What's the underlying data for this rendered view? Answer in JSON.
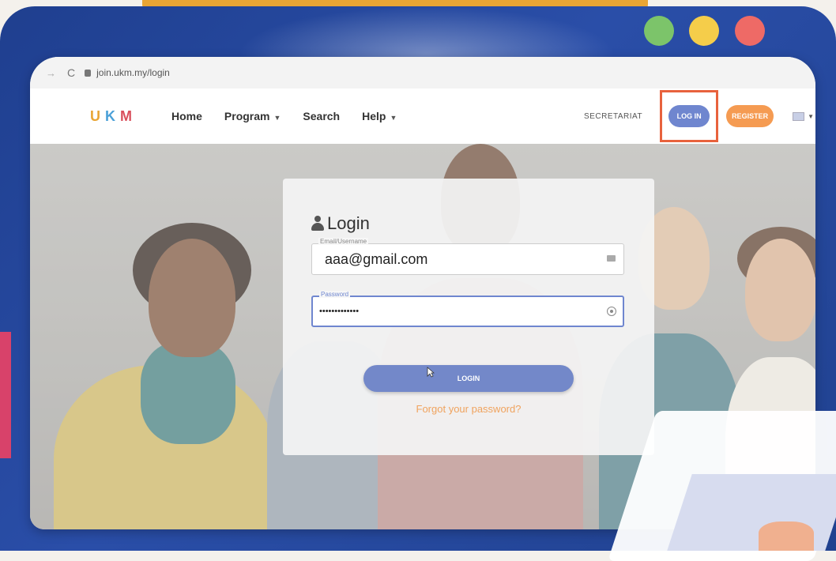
{
  "browser": {
    "url": "join.ukm.my/login"
  },
  "navbar": {
    "logo": {
      "u": "U",
      "k": "K",
      "m": "M"
    },
    "links": [
      {
        "label": "Home"
      },
      {
        "label": "Program"
      },
      {
        "label": "Search"
      },
      {
        "label": "Help"
      }
    ],
    "secretariat_label": "SECRETARIAT",
    "login_label": "LOG IN",
    "register_label": "REGISTER"
  },
  "login_form": {
    "title": "Login",
    "email_label": "Email/Username",
    "email_value": "aaa@gmail.com",
    "password_label": "Password",
    "password_value": "•••••••••••••",
    "submit_label": "LOGIN",
    "forgot_label": "Forgot your password?"
  },
  "colors": {
    "accent": "#6f86cf",
    "register": "#f59b52",
    "highlight": "#e8623d",
    "forgot_link": "#f0a35e"
  }
}
